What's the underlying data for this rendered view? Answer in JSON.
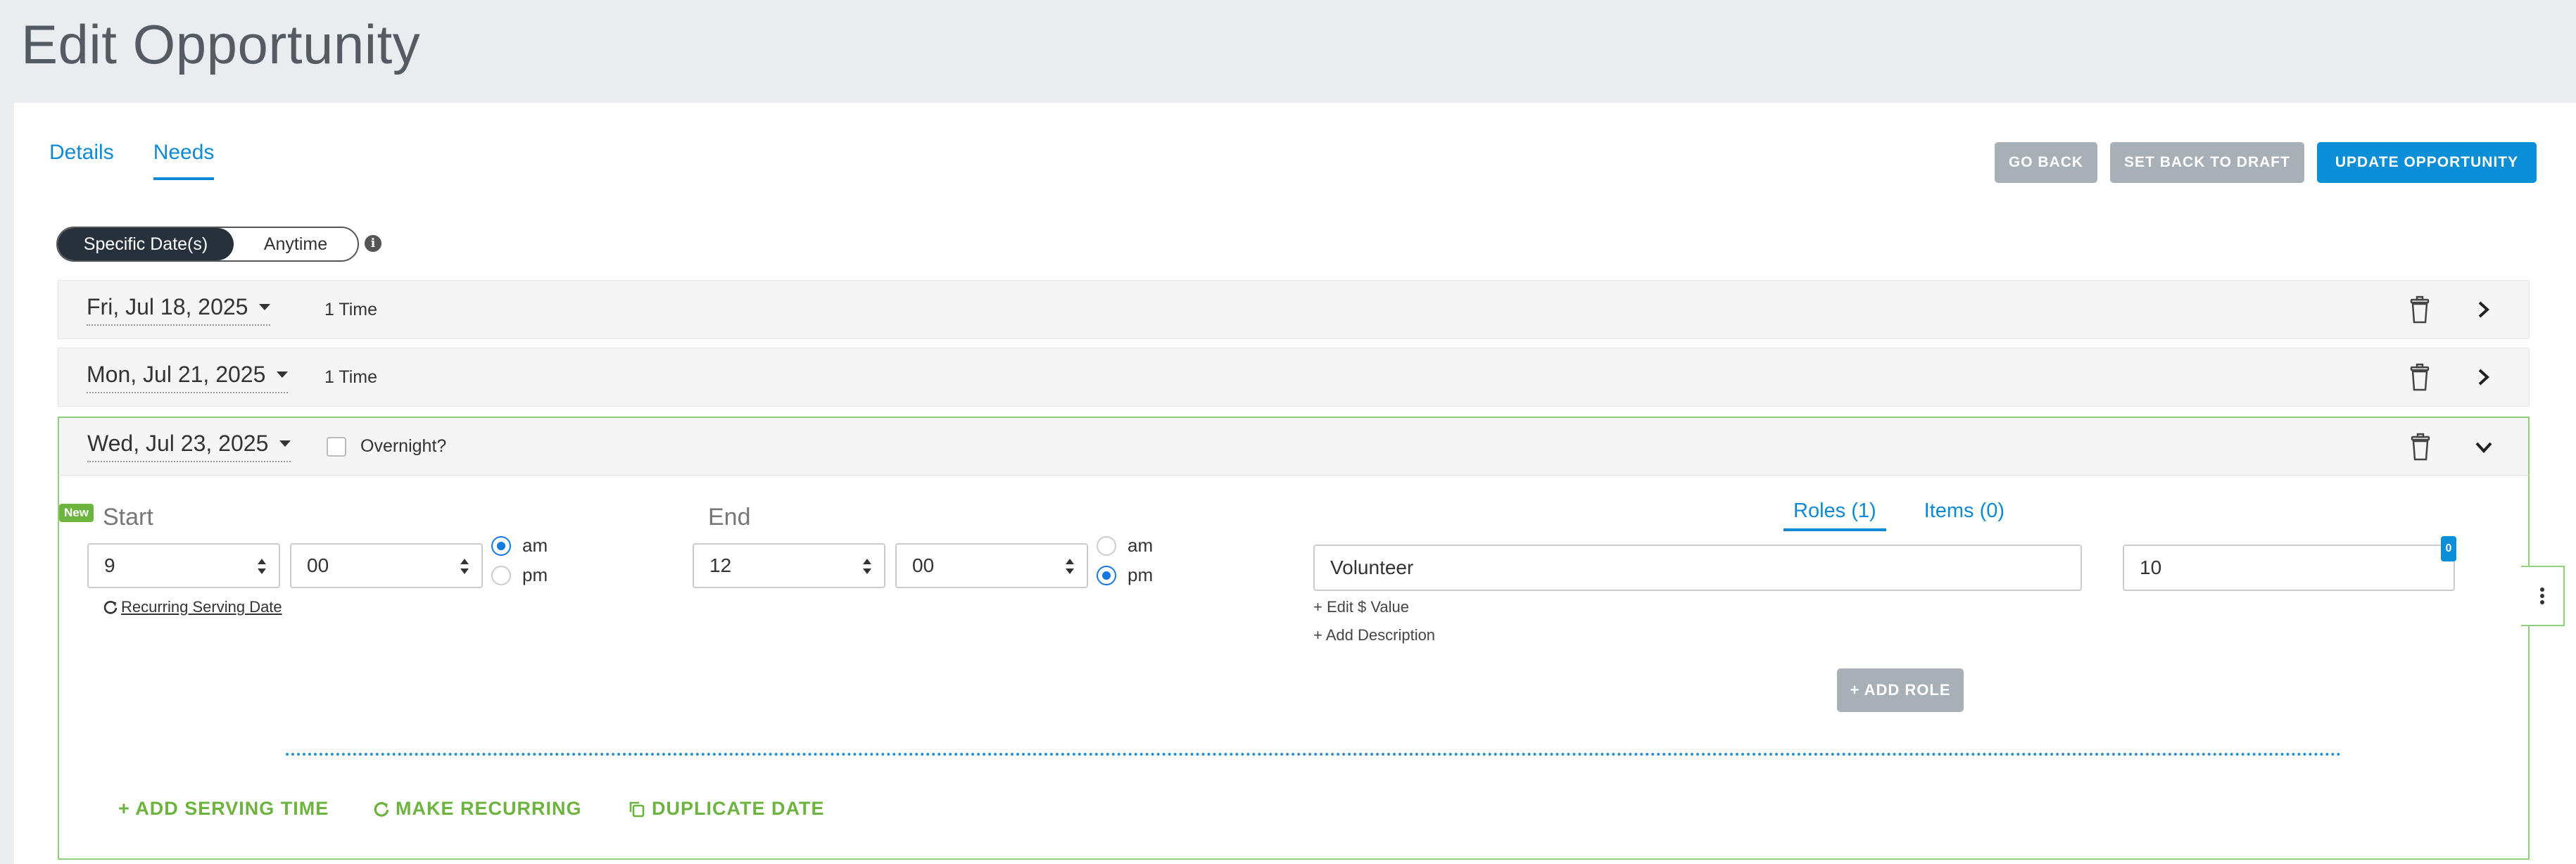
{
  "page": {
    "title": "Edit Opportunity"
  },
  "tabs": [
    {
      "label": "Details",
      "active": false
    },
    {
      "label": "Needs",
      "active": true
    }
  ],
  "buttons": {
    "go_back": "GO BACK",
    "set_draft": "SET BACK TO DRAFT",
    "update": "UPDATE OPPORTUNITY"
  },
  "schedule_toggle": {
    "specific": "Specific Date(s)",
    "anytime": "Anytime",
    "selected": "Specific Date(s)",
    "info_icon": "info-icon"
  },
  "dates": [
    {
      "label": "Fri, Jul 18, 2025",
      "summary": "1 Time",
      "expanded": false
    },
    {
      "label": "Mon, Jul 21, 2025",
      "summary": "1 Time",
      "expanded": false
    },
    {
      "label": "Wed, Jul 23, 2025",
      "overnight_label": "Overnight?",
      "overnight_checked": false,
      "expanded": true
    }
  ],
  "serving_time": {
    "new_badge": "New",
    "start_label": "Start",
    "end_label": "End",
    "start_hour": "9",
    "start_min": "00",
    "end_hour": "12",
    "end_min": "00",
    "am": "am",
    "pm": "pm",
    "start_period": "am",
    "end_period": "pm",
    "recurring_link": "Recurring Serving Date"
  },
  "roles": {
    "roles_tab": "Roles (1)",
    "items_tab": "Items (0)",
    "role_name": "Volunteer",
    "quantity": "10",
    "quantity_badge": "0",
    "edit_value": "+ Edit $ Value",
    "add_description": "+ Add Description",
    "add_role": "+ ADD ROLE"
  },
  "actions": {
    "add_serving_time": "+ ADD SERVING TIME",
    "make_recurring": "MAKE RECURRING",
    "duplicate_date": "DUPLICATE DATE"
  },
  "colors": {
    "accent": "#0c8fd6",
    "green": "#6db33f",
    "grey_button": "#a8b0b7"
  }
}
